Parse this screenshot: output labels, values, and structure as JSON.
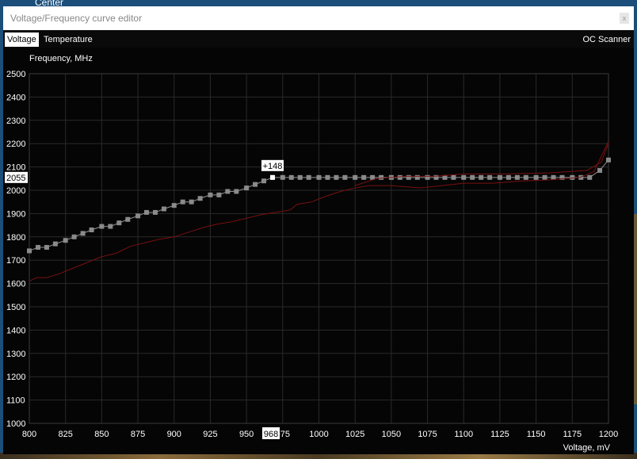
{
  "desktop": {
    "label": "Center"
  },
  "window": {
    "title": "Voltage/Frequency curve editor",
    "close_glyph": "x"
  },
  "tabs": [
    {
      "label": "Voltage"
    },
    {
      "label": "Temperature"
    }
  ],
  "toolbar": {
    "oc_scanner_label": "OC Scanner"
  },
  "readouts": {
    "selected_frequency": "2055",
    "selected_voltage": "968",
    "offset": "+148"
  },
  "colors": {
    "background": "#050505",
    "grid": "#2a2a2a",
    "curve": "#909090",
    "point": "#8a8a8a",
    "selected_point": "#ffffff",
    "default_curve": "#7a1010",
    "accent_label_bg": "#ffffff"
  },
  "chart_data": {
    "type": "line",
    "ylabel": "Frequency, MHz",
    "xlabel": "Voltage, mV",
    "xlim": [
      800,
      1200
    ],
    "ylim": [
      1000,
      2500
    ],
    "xticks": [
      800,
      825,
      850,
      875,
      900,
      925,
      950,
      975,
      1000,
      1025,
      1050,
      1075,
      1100,
      1125,
      1150,
      1175,
      1200
    ],
    "xtick_labels": [
      "800",
      "825",
      "850",
      "875",
      "900",
      "925",
      "950",
      "975",
      "1000",
      "1025",
      "1050",
      "1075",
      "1100",
      "1125",
      "1150",
      "1175",
      "1200"
    ],
    "yticks": [
      1000,
      1100,
      1200,
      1300,
      1400,
      1500,
      1600,
      1700,
      1800,
      1900,
      2000,
      2100,
      2200,
      2300,
      2400,
      2500
    ],
    "ytick_labels": [
      "1000",
      "1100",
      "1200",
      "1300",
      "1400",
      "1500",
      "1600",
      "1700",
      "1800",
      "1900",
      "2000",
      "2100",
      "2200",
      "2300",
      "2400",
      "2500"
    ],
    "grid": true,
    "selected_point": {
      "x": 968,
      "y": 2055,
      "offset": "+148"
    },
    "series": [
      {
        "role": "curve",
        "points": [
          [
            800,
            1740
          ],
          [
            806,
            1755
          ],
          [
            812,
            1755
          ],
          [
            818,
            1770
          ],
          [
            825,
            1785
          ],
          [
            831,
            1800
          ],
          [
            837,
            1815
          ],
          [
            843,
            1830
          ],
          [
            850,
            1845
          ],
          [
            856,
            1845
          ],
          [
            862,
            1860
          ],
          [
            868,
            1875
          ],
          [
            875,
            1890
          ],
          [
            881,
            1905
          ],
          [
            887,
            1905
          ],
          [
            893,
            1920
          ],
          [
            900,
            1935
          ],
          [
            906,
            1950
          ],
          [
            912,
            1950
          ],
          [
            918,
            1965
          ],
          [
            925,
            1980
          ],
          [
            931,
            1980
          ],
          [
            937,
            1995
          ],
          [
            943,
            1995
          ],
          [
            950,
            2010
          ],
          [
            956,
            2025
          ],
          [
            962,
            2040
          ],
          [
            968,
            2055
          ],
          [
            975,
            2055
          ],
          [
            981,
            2055
          ],
          [
            987,
            2055
          ],
          [
            993,
            2055
          ],
          [
            1000,
            2055
          ],
          [
            1006,
            2055
          ],
          [
            1012,
            2055
          ],
          [
            1018,
            2055
          ],
          [
            1025,
            2055
          ],
          [
            1031,
            2055
          ],
          [
            1037,
            2055
          ],
          [
            1043,
            2055
          ],
          [
            1050,
            2055
          ],
          [
            1056,
            2055
          ],
          [
            1062,
            2055
          ],
          [
            1068,
            2055
          ],
          [
            1075,
            2055
          ],
          [
            1081,
            2055
          ],
          [
            1087,
            2055
          ],
          [
            1093,
            2055
          ],
          [
            1100,
            2055
          ],
          [
            1106,
            2055
          ],
          [
            1112,
            2055
          ],
          [
            1118,
            2055
          ],
          [
            1125,
            2055
          ],
          [
            1131,
            2055
          ],
          [
            1137,
            2055
          ],
          [
            1143,
            2055
          ],
          [
            1150,
            2055
          ],
          [
            1156,
            2055
          ],
          [
            1162,
            2055
          ],
          [
            1168,
            2055
          ],
          [
            1175,
            2055
          ],
          [
            1181,
            2055
          ],
          [
            1187,
            2055
          ],
          [
            1194,
            2085
          ],
          [
            1200,
            2130
          ]
        ]
      },
      {
        "role": "default-curve",
        "points": [
          [
            800,
            1610
          ],
          [
            805,
            1625
          ],
          [
            812,
            1625
          ],
          [
            820,
            1640
          ],
          [
            830,
            1665
          ],
          [
            840,
            1690
          ],
          [
            850,
            1715
          ],
          [
            860,
            1730
          ],
          [
            870,
            1760
          ],
          [
            880,
            1775
          ],
          [
            890,
            1790
          ],
          [
            900,
            1800
          ],
          [
            910,
            1820
          ],
          [
            920,
            1840
          ],
          [
            930,
            1855
          ],
          [
            940,
            1865
          ],
          [
            950,
            1880
          ],
          [
            960,
            1895
          ],
          [
            970,
            1905
          ],
          [
            980,
            1915
          ],
          [
            985,
            1940
          ],
          [
            995,
            1950
          ],
          [
            1005,
            1975
          ],
          [
            1015,
            1995
          ],
          [
            1025,
            2010
          ],
          [
            1035,
            2020
          ],
          [
            1050,
            2020
          ],
          [
            1060,
            2015
          ],
          [
            1070,
            2010
          ],
          [
            1085,
            2020
          ],
          [
            1100,
            2030
          ],
          [
            1120,
            2030
          ],
          [
            1140,
            2040
          ],
          [
            1160,
            2045
          ],
          [
            1180,
            2055
          ],
          [
            1190,
            2080
          ],
          [
            1200,
            2210
          ]
        ]
      },
      {
        "role": "default-curve-upper",
        "points": [
          [
            1025,
            2020
          ],
          [
            1040,
            2050
          ],
          [
            1060,
            2060
          ],
          [
            1080,
            2060
          ],
          [
            1100,
            2070
          ],
          [
            1130,
            2070
          ],
          [
            1160,
            2075
          ],
          [
            1185,
            2085
          ],
          [
            1195,
            2120
          ],
          [
            1200,
            2200
          ]
        ]
      }
    ]
  }
}
